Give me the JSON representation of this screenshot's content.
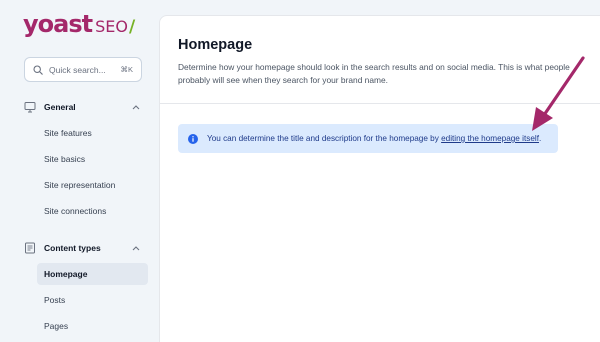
{
  "brand": {
    "name": "yoast",
    "product": "SEO",
    "slash": "/"
  },
  "search": {
    "placeholder": "Quick search...",
    "shortcut": "⌘K"
  },
  "sidebar": {
    "groups": [
      {
        "label": "General",
        "icon": "desktop-icon",
        "expanded": true,
        "items": [
          {
            "label": "Site features"
          },
          {
            "label": "Site basics"
          },
          {
            "label": "Site representation"
          },
          {
            "label": "Site connections"
          }
        ]
      },
      {
        "label": "Content types",
        "icon": "document-icon",
        "expanded": true,
        "items": [
          {
            "label": "Homepage",
            "active": true
          },
          {
            "label": "Posts"
          },
          {
            "label": "Pages"
          }
        ]
      }
    ]
  },
  "main": {
    "title": "Homepage",
    "description": "Determine how your homepage should look in the search results and on social media. This is what people probably will see when they search for your brand name.",
    "alert": {
      "text": "You can determine the title and description for the homepage by",
      "link_text": "editing the homepage itself",
      "suffix": "."
    }
  },
  "colors": {
    "brand": "#a4286a",
    "accent_green": "#77b227",
    "alert_bg": "#dbeafe",
    "alert_icon": "#2563eb",
    "arrow": "#a4286a"
  }
}
